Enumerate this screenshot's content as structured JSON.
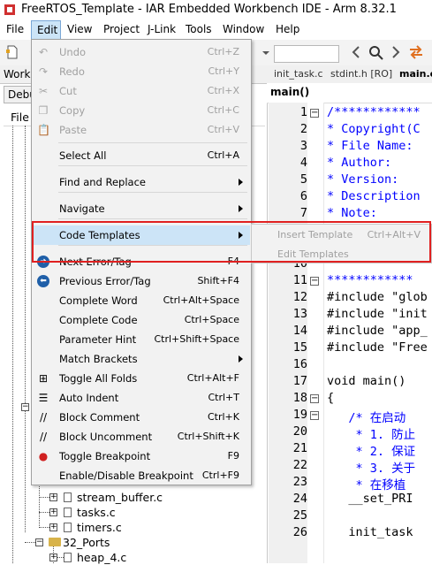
{
  "window": {
    "title": "FreeRTOS_Template - IAR Embedded Workbench IDE - Arm 8.32.1"
  },
  "menubar": [
    "File",
    "Edit",
    "View",
    "Project",
    "J-Link",
    "Tools",
    "Window",
    "Help"
  ],
  "workspace": {
    "header": "Works",
    "config": "Debu",
    "files_header": "File"
  },
  "tree": [
    {
      "label": "stream_buffer.c",
      "type": "file"
    },
    {
      "label": "tasks.c",
      "type": "file"
    },
    {
      "label": "timers.c",
      "type": "file"
    },
    {
      "label": "32_Ports",
      "type": "folder"
    },
    {
      "label": "heap_4.c",
      "type": "file"
    }
  ],
  "editor": {
    "tabs": [
      "init_task.c",
      "stdint.h [RO]",
      "main.c"
    ],
    "function": "main()",
    "line_numbers": [
      "1",
      "2",
      "3",
      "4",
      "5",
      "6",
      "7",
      "8",
      "9",
      "10",
      "11",
      "12",
      "13",
      "14",
      "15",
      "16",
      "17",
      "18",
      "19",
      "20",
      "21",
      "22",
      "23",
      "24",
      "25",
      "26"
    ],
    "lines": [
      "/************",
      "* Copyright(C",
      "* File Name:",
      "* Author:",
      "* Version:",
      "* Description",
      "* Note:",
      "",
      "",
      "",
      "************",
      "#include \"glob",
      "#include \"init",
      "#include \"app_",
      "#include \"Free",
      "",
      "void main()",
      "{",
      "   /* 在启动",
      "    * 1. 防止",
      "    * 2. 保证",
      "    * 3. 关于",
      "    * 在移植",
      "   __set_PRI",
      "",
      "   init_task"
    ]
  },
  "edit_menu": {
    "items": [
      {
        "label": "Undo",
        "shortcut": "Ctrl+Z",
        "enabled": false,
        "icon": "undo-icon"
      },
      {
        "label": "Redo",
        "shortcut": "Ctrl+Y",
        "enabled": false,
        "icon": "redo-icon"
      },
      {
        "label": "Cut",
        "shortcut": "Ctrl+X",
        "enabled": false,
        "icon": "cut-icon"
      },
      {
        "label": "Copy",
        "shortcut": "Ctrl+C",
        "enabled": false,
        "icon": "copy-icon"
      },
      {
        "label": "Paste",
        "shortcut": "Ctrl+V",
        "enabled": false,
        "icon": "paste-icon"
      },
      {
        "label": "Select All",
        "shortcut": "Ctrl+A",
        "enabled": true
      },
      {
        "label": "Find and Replace",
        "shortcut": "",
        "enabled": true,
        "submenu": true
      },
      {
        "label": "Navigate",
        "shortcut": "",
        "enabled": true,
        "submenu": true
      },
      {
        "label": "Code Templates",
        "shortcut": "",
        "enabled": true,
        "submenu": true
      },
      {
        "label": "Next Error/Tag",
        "shortcut": "F4",
        "enabled": true,
        "icon": "next-error-icon"
      },
      {
        "label": "Previous Error/Tag",
        "shortcut": "Shift+F4",
        "enabled": true,
        "icon": "previous-error-icon"
      },
      {
        "label": "Complete Word",
        "shortcut": "Ctrl+Alt+Space",
        "enabled": true
      },
      {
        "label": "Complete Code",
        "shortcut": "Ctrl+Space",
        "enabled": true
      },
      {
        "label": "Parameter Hint",
        "shortcut": "Ctrl+Shift+Space",
        "enabled": true
      },
      {
        "label": "Match Brackets",
        "shortcut": "",
        "enabled": true,
        "submenu": true
      },
      {
        "label": "Toggle All Folds",
        "shortcut": "Ctrl+Alt+F",
        "enabled": true,
        "icon": "toggle-folds-icon"
      },
      {
        "label": "Auto Indent",
        "shortcut": "Ctrl+T",
        "enabled": true,
        "icon": "auto-indent-icon"
      },
      {
        "label": "Block Comment",
        "shortcut": "Ctrl+K",
        "enabled": true,
        "icon": "block-comment-icon"
      },
      {
        "label": "Block Uncomment",
        "shortcut": "Ctrl+Shift+K",
        "enabled": true,
        "icon": "block-uncomment-icon"
      },
      {
        "label": "Toggle Breakpoint",
        "shortcut": "F9",
        "enabled": true,
        "icon": "breakpoint-icon"
      },
      {
        "label": "Enable/Disable Breakpoint",
        "shortcut": "Ctrl+F9",
        "enabled": true
      }
    ]
  },
  "code_templates_submenu": {
    "items": [
      {
        "label": "Insert Template",
        "shortcut": "Ctrl+Alt+V",
        "enabled": false
      },
      {
        "label": "Edit Templates",
        "shortcut": "",
        "enabled": false
      }
    ]
  },
  "colors": {
    "highlight_box": "#e02020",
    "menu_bg": "#f2f2f2",
    "menu_active": "#cce4f7",
    "keyword": "#0000ff",
    "comment": "#0000ff"
  }
}
